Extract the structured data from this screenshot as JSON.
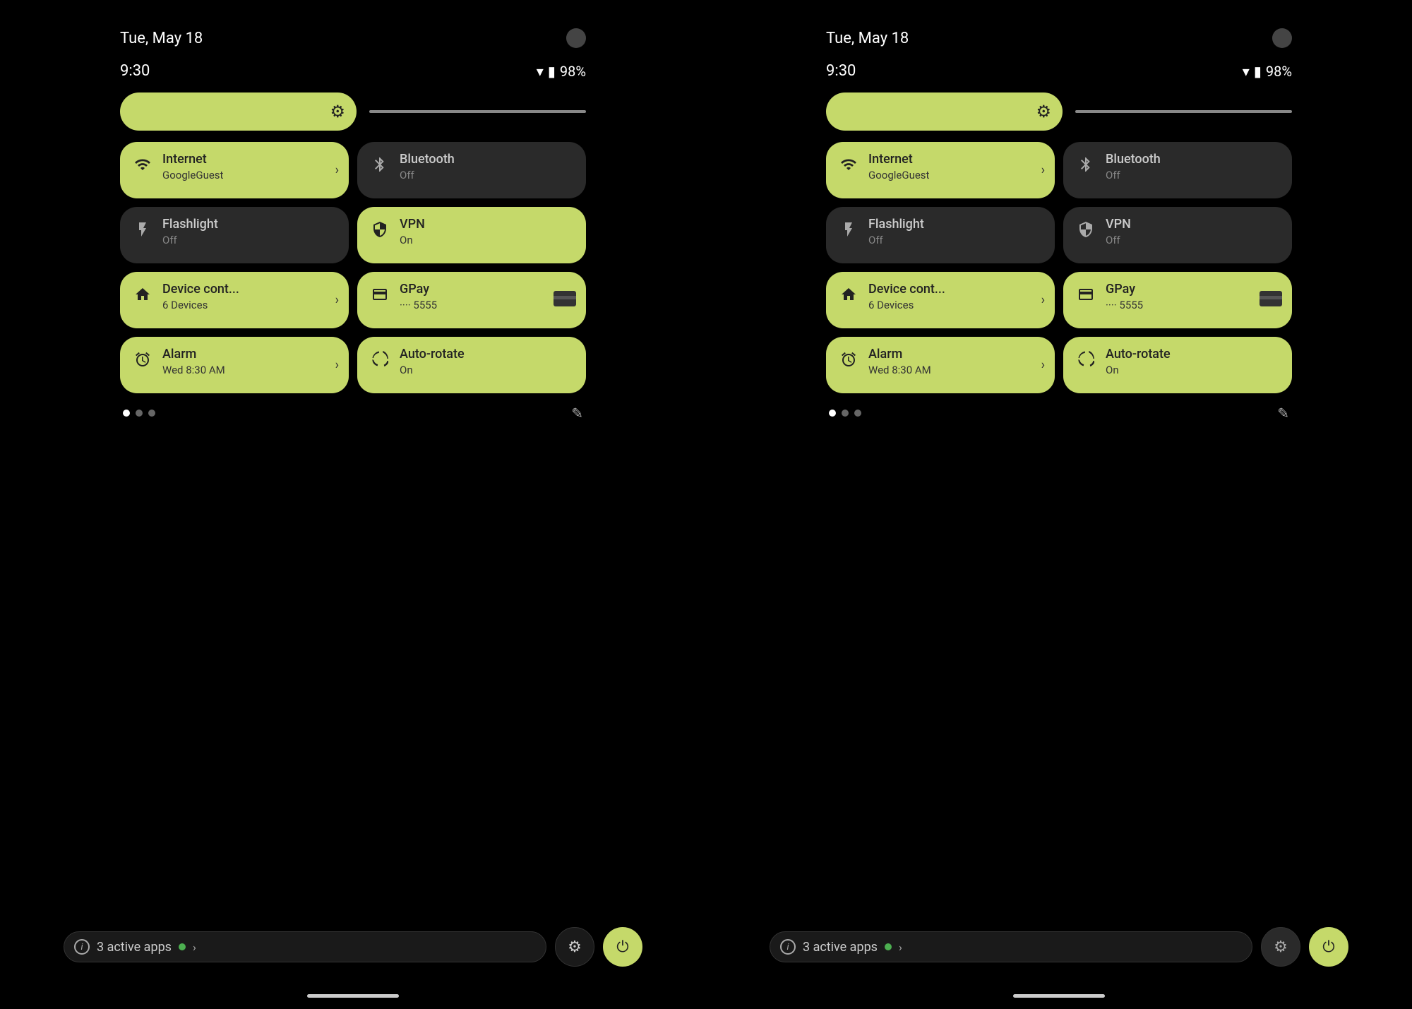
{
  "screens": [
    {
      "id": "screen-left",
      "statusBar": {
        "date": "Tue, May 18",
        "time": "9:30",
        "battery": "98%"
      },
      "brightness": {
        "icon": "⚙"
      },
      "tiles": [
        {
          "id": "internet",
          "icon": "▾",
          "title": "Internet",
          "subtitle": "GoogleGuest",
          "state": "active",
          "chevron": true
        },
        {
          "id": "bluetooth",
          "icon": "✱",
          "title": "Bluetooth",
          "subtitle": "Off",
          "state": "inactive",
          "chevron": false
        },
        {
          "id": "flashlight",
          "icon": "▯",
          "title": "Flashlight",
          "subtitle": "Off",
          "state": "inactive",
          "chevron": false
        },
        {
          "id": "vpn",
          "icon": "⊕",
          "title": "VPN",
          "subtitle": "On",
          "state": "active",
          "chevron": false
        },
        {
          "id": "device",
          "icon": "⌂",
          "title": "Device cont...",
          "subtitle": "6 Devices",
          "state": "active",
          "chevron": true
        },
        {
          "id": "gpay",
          "icon": "▬",
          "title": "GPay",
          "subtitle": "···· 5555",
          "state": "active",
          "chevron": false,
          "card": true
        },
        {
          "id": "alarm",
          "icon": "◷",
          "title": "Alarm",
          "subtitle": "Wed 8:30 AM",
          "state": "active",
          "chevron": true
        },
        {
          "id": "autorotate",
          "icon": "↻",
          "title": "Auto-rotate",
          "subtitle": "On",
          "state": "active",
          "chevron": false
        }
      ],
      "dots": [
        true,
        false,
        false
      ],
      "bottomBar": {
        "activeAppsCount": "3",
        "activeAppsLabel": "active apps"
      }
    },
    {
      "id": "screen-right",
      "statusBar": {
        "date": "Tue, May 18",
        "time": "9:30",
        "battery": "98%"
      },
      "brightness": {
        "icon": "⚙"
      },
      "tiles": [
        {
          "id": "internet",
          "icon": "▾",
          "title": "Internet",
          "subtitle": "GoogleGuest",
          "state": "active",
          "chevron": true
        },
        {
          "id": "bluetooth",
          "icon": "✱",
          "title": "Bluetooth",
          "subtitle": "Off",
          "state": "inactive",
          "chevron": false
        },
        {
          "id": "flashlight",
          "icon": "▯",
          "title": "Flashlight",
          "subtitle": "Off",
          "state": "inactive",
          "chevron": false
        },
        {
          "id": "vpn",
          "icon": "⊕",
          "title": "VPN",
          "subtitle": "Off",
          "state": "inactive",
          "chevron": false
        },
        {
          "id": "device",
          "icon": "⌂",
          "title": "Device cont...",
          "subtitle": "6 Devices",
          "state": "active",
          "chevron": true
        },
        {
          "id": "gpay",
          "icon": "▬",
          "title": "GPay",
          "subtitle": "···· 5555",
          "state": "active",
          "chevron": false,
          "card": true
        },
        {
          "id": "alarm",
          "icon": "◷",
          "title": "Alarm",
          "subtitle": "Wed 8:30 AM",
          "state": "active",
          "chevron": true
        },
        {
          "id": "autorotate",
          "icon": "↻",
          "title": "Auto-rotate",
          "subtitle": "On",
          "state": "active",
          "chevron": false
        }
      ],
      "dots": [
        true,
        false,
        false
      ],
      "bottomBar": {
        "activeAppsCount": "3",
        "activeAppsLabel": "active apps"
      }
    }
  ],
  "icons": {
    "wifi": "▾",
    "battery": "🔋",
    "edit": "✎",
    "power": "⏻",
    "settings": "⚙"
  }
}
